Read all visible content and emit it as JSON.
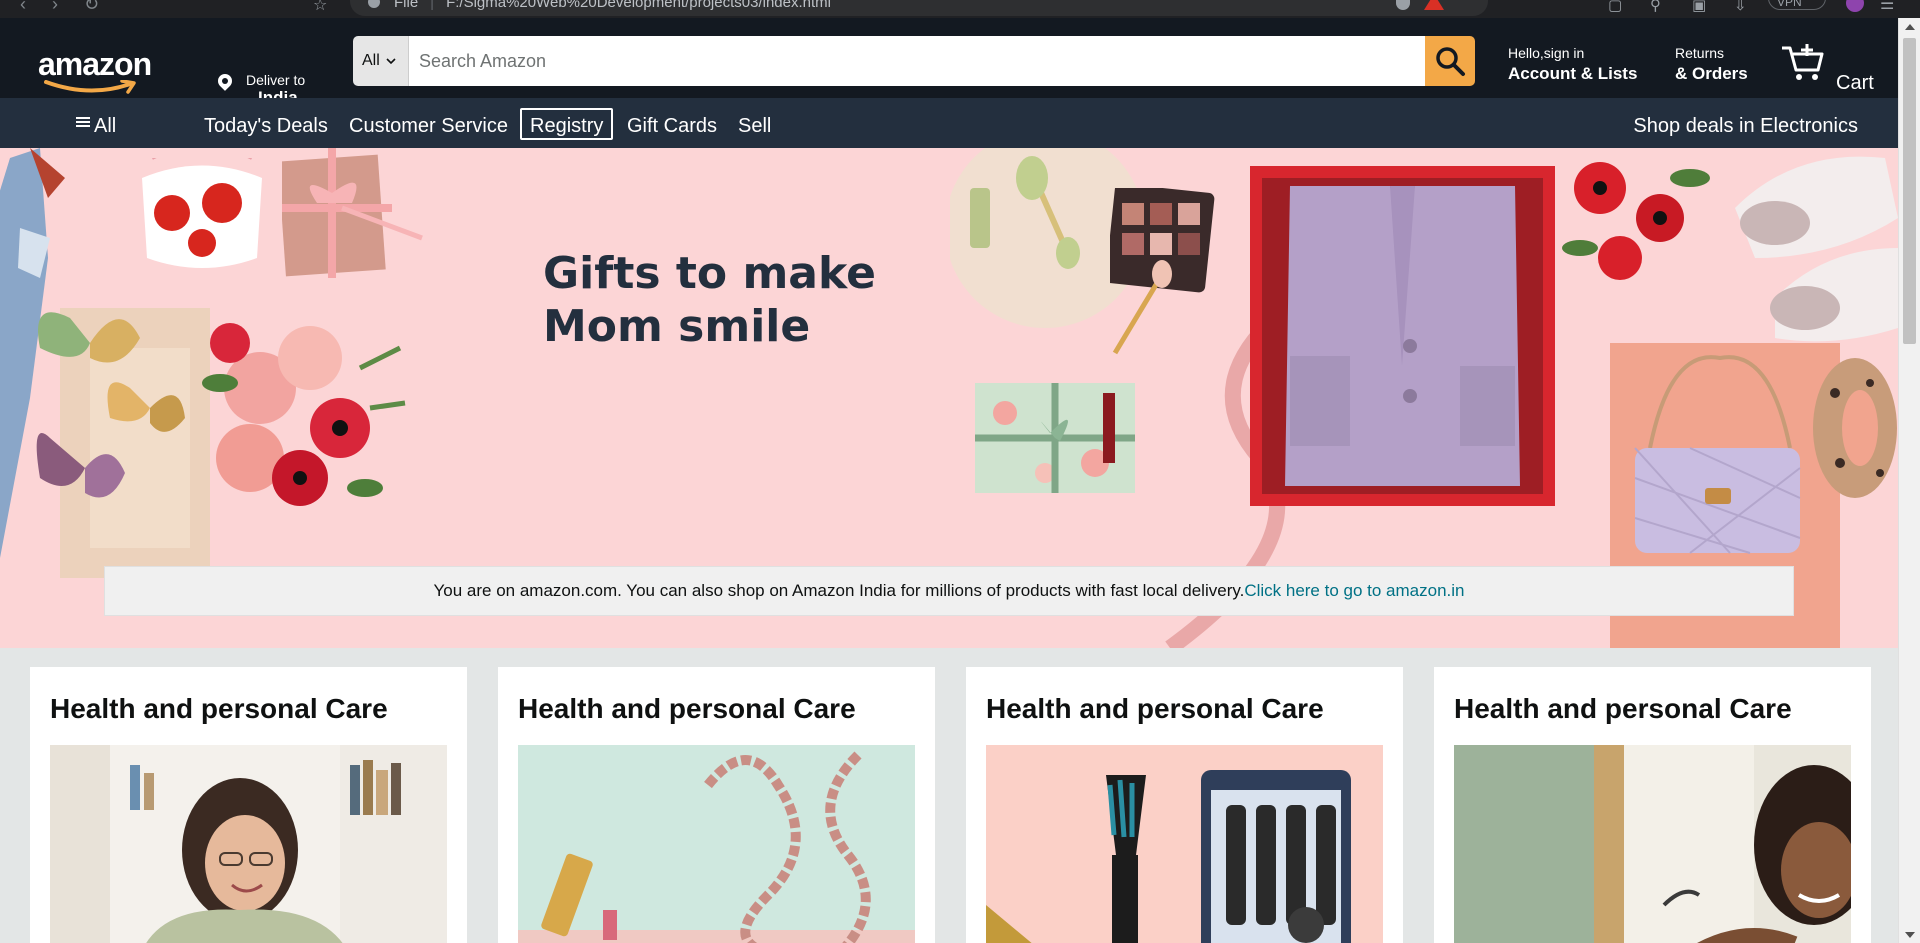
{
  "browser": {
    "url": "F:/Sigma%20Web%20Development/projects03/index.html",
    "url_prefix": "File",
    "vpn_label": "VPN"
  },
  "header": {
    "deliver_line1": "Deliver to",
    "deliver_line2": "India",
    "search_category": "All",
    "search_placeholder": "Search Amazon",
    "account_line1": "Hello,sign in",
    "account_line2": "Account & Lists",
    "orders_line1": "Returns",
    "orders_line2": "& Orders",
    "cart_label": "Cart"
  },
  "nav": {
    "all_label": "All",
    "items": [
      "Today's Deals",
      "Customer Service",
      "Registry",
      "Gift Cards",
      "Sell"
    ],
    "promo": "Shop deals in Electronics"
  },
  "hero": {
    "headline_line1": "Gifts to make",
    "headline_line2": "Mom smile",
    "notice_text": "You are on amazon.com. You can also shop on Amazon India for millions of products with fast local delivery.",
    "notice_link": "Click here to go to amazon.in"
  },
  "cards": [
    {
      "title": "Health and personal Care"
    },
    {
      "title": "Health and personal Care"
    },
    {
      "title": "Health and personal Care"
    },
    {
      "title": "Health and personal Care"
    }
  ],
  "colors": {
    "header_bg": "#131921",
    "nav_bg": "#232f3e",
    "search_button": "#f3a847",
    "hero_bg": "#fcd5d6",
    "link": "#007185"
  }
}
